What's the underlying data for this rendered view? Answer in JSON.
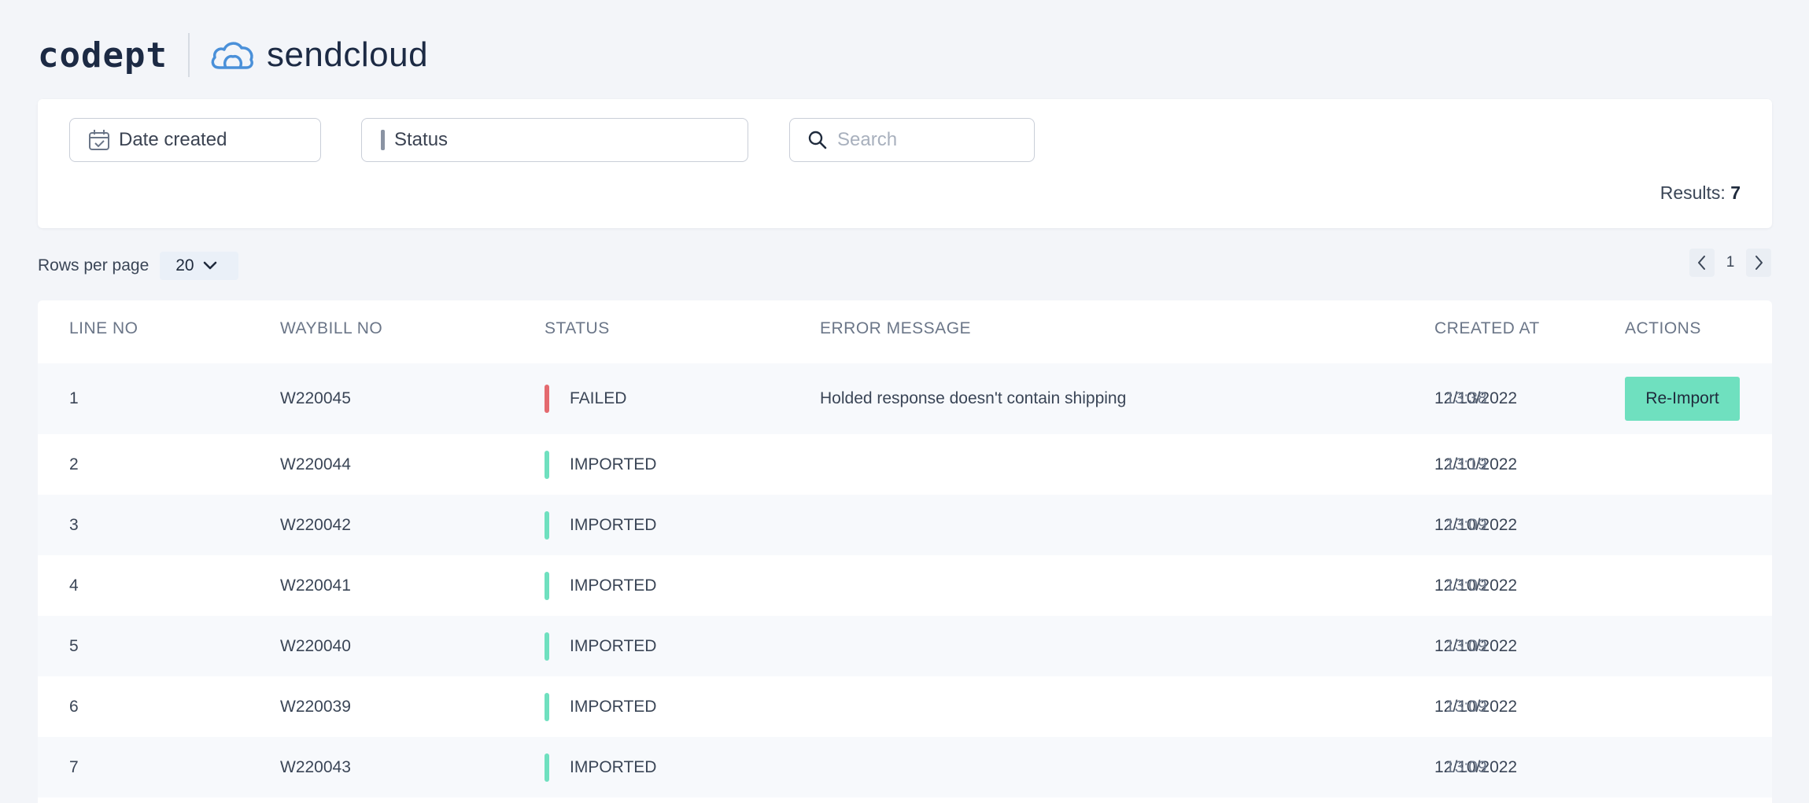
{
  "brand": {
    "primary": "codept",
    "secondary": "sendcloud"
  },
  "filters": {
    "date_label": "Date created",
    "status_label": "Status",
    "search_placeholder": "Search",
    "results_label": "Results:",
    "results_count": "7"
  },
  "pagination": {
    "rows_per_page_label": "Rows per page",
    "rows_per_page_value": "20",
    "current_page": "1"
  },
  "table": {
    "headers": {
      "line_no": "LINE NO",
      "waybill_no": "WAYBILL NO",
      "status": "STATUS",
      "error_message": "ERROR MESSAGE",
      "created_at": "CREATED AT",
      "actions": "ACTIONS"
    },
    "rows": [
      {
        "line": "1",
        "waybill": "W220045",
        "status": "FAILED",
        "error": "Holded response doesn't contain shipping",
        "date": "12/10/2022",
        "time": "13:38",
        "action": "Re-Import"
      },
      {
        "line": "2",
        "waybill": "W220044",
        "status": "IMPORTED",
        "error": "",
        "date": "12/10/2022",
        "time": "13:19",
        "action": ""
      },
      {
        "line": "3",
        "waybill": "W220042",
        "status": "IMPORTED",
        "error": "",
        "date": "12/10/2022",
        "time": "13:09",
        "action": ""
      },
      {
        "line": "4",
        "waybill": "W220041",
        "status": "IMPORTED",
        "error": "",
        "date": "12/10/2022",
        "time": "13:09",
        "action": ""
      },
      {
        "line": "5",
        "waybill": "W220040",
        "status": "IMPORTED",
        "error": "",
        "date": "12/10/2022",
        "time": "13:09",
        "action": ""
      },
      {
        "line": "6",
        "waybill": "W220039",
        "status": "IMPORTED",
        "error": "",
        "date": "12/10/2022",
        "time": "13:09",
        "action": ""
      },
      {
        "line": "7",
        "waybill": "W220043",
        "status": "IMPORTED",
        "error": "",
        "date": "12/10/2022",
        "time": "13:09",
        "action": ""
      }
    ]
  },
  "colors": {
    "failed": "#e46a6f",
    "imported": "#6fe0bf",
    "action_button": "#6fe0bf",
    "background": "#f3f5f9"
  },
  "icons": [
    "calendar-icon",
    "search-icon",
    "chevron-down-icon",
    "chevron-left-icon",
    "chevron-right-icon",
    "cloud-logo-icon"
  ]
}
